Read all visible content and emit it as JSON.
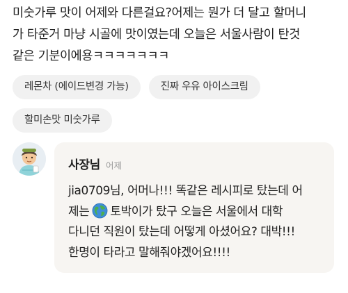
{
  "review": {
    "lines": [
      "미숫가루 맛이 어제와 다른걸요?어제는 뭔가 더 달고 할머니",
      "가 타준거 마냥 시골에 맛이였는데  오늘은 서울사람이 탄것",
      "같은 기분이에용ㅋㅋㅋㅋㅋㅋㅋ"
    ]
  },
  "tags": [
    "레몬차 (에이드변경 가능)",
    "진짜 우유 아이스크림",
    "할미손맛 미숫가루"
  ],
  "reply": {
    "author": "사장님",
    "date": "어제",
    "line1": "jia0709님, 어머나!!! 똑같은 레시피로 탔는데 어",
    "line2_before": "제는",
    "line2_icon": "earth-globe-icon",
    "line2_after": "토박이가 탔구 오늘은 서울에서 대학",
    "line3": "다니던 직원이 탔는데 어떻게 아셨어요? 대박!!!",
    "line4": "한명이 타라고 말해줘야겠어요!!!!"
  }
}
